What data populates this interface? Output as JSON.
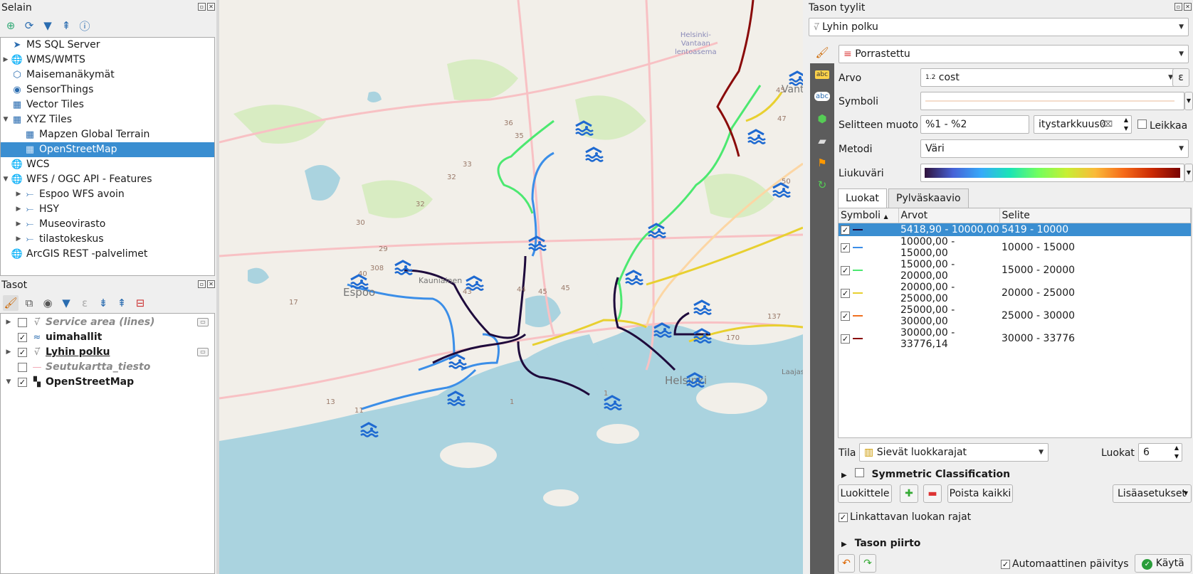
{
  "browser": {
    "title": "Selain",
    "items": [
      {
        "label": "MS SQL Server",
        "icon": "mssql-icon",
        "expand": false,
        "indent": 0
      },
      {
        "label": "WMS/WMTS",
        "icon": "wms-icon",
        "expand": true,
        "indent": 0
      },
      {
        "label": "Maisemanäkymät",
        "icon": "scene-icon",
        "expand": false,
        "indent": 0
      },
      {
        "label": "SensorThings",
        "icon": "sensor-icon",
        "expand": false,
        "indent": 0
      },
      {
        "label": "Vector Tiles",
        "icon": "vector-tiles-icon",
        "expand": false,
        "indent": 0
      },
      {
        "label": "XYZ Tiles",
        "icon": "xyz-tiles-icon",
        "expand": "open",
        "indent": 0
      },
      {
        "label": "Mapzen Global Terrain",
        "icon": "tile-icon",
        "expand": false,
        "indent": 1
      },
      {
        "label": "OpenStreetMap",
        "icon": "tile-icon",
        "expand": false,
        "indent": 1,
        "selected": true
      },
      {
        "label": "WCS",
        "icon": "wcs-icon",
        "expand": false,
        "indent": 0
      },
      {
        "label": "WFS / OGC API - Features",
        "icon": "wfs-icon",
        "expand": "open",
        "indent": 0
      },
      {
        "label": "Espoo WFS avoin",
        "icon": "wfs-conn-icon",
        "expand": true,
        "indent": 1
      },
      {
        "label": "HSY",
        "icon": "wfs-conn-icon",
        "expand": true,
        "indent": 1
      },
      {
        "label": "Museovirasto",
        "icon": "wfs-conn-icon",
        "expand": true,
        "indent": 1
      },
      {
        "label": "tilastokeskus",
        "icon": "wfs-conn-icon",
        "expand": true,
        "indent": 1
      },
      {
        "label": "ArcGIS REST -palvelimet",
        "icon": "arcgis-icon",
        "expand": false,
        "indent": 0
      }
    ]
  },
  "layers": {
    "title": "Tasot",
    "items": [
      {
        "label": "Service area (lines)",
        "checked": false,
        "style": "italic-gray",
        "icon": "line-layer-icon",
        "expand": true
      },
      {
        "label": "uimahallit",
        "checked": true,
        "style": "bold",
        "icon": "swimming-pool-icon",
        "expand": false
      },
      {
        "label": "Lyhin polku",
        "checked": true,
        "style": "bold-underline",
        "icon": "line-layer-icon",
        "expand": true
      },
      {
        "label": "Seutukartta_tiesto",
        "checked": false,
        "style": "italic-gray",
        "icon": "pink-line-icon",
        "expand": false
      },
      {
        "label": "OpenStreetMap",
        "checked": true,
        "style": "bold",
        "icon": "raster-icon",
        "expand": "open"
      }
    ]
  },
  "map": {
    "labels": {
      "espoo": "Espoo",
      "helsinki": "Helsinki",
      "kauniainen": "Kauniainen",
      "airport1": "Helsinki-",
      "airport2": "Vantaan",
      "airport3": "lentoasema",
      "laajasalo": "Laajas",
      "vantaa": "Vant"
    },
    "road_numbers": [
      "36",
      "35",
      "33",
      "32",
      "32",
      "30",
      "29",
      "308",
      "40",
      "45",
      "44",
      "43",
      "45",
      "17",
      "13",
      "11",
      "170",
      "47",
      "45",
      "50",
      "137",
      "1",
      "1"
    ]
  },
  "styles": {
    "title": "Tason tyylit",
    "layer_select": "Lyhin polku",
    "renderer": "Porrastettu",
    "arvo_label": "Arvo",
    "arvo_value": "cost",
    "arvo_prefix": "1.2",
    "symboli_label": "Symboli",
    "selite_label": "Selitteen muoto",
    "selite_value": "%1 - %2",
    "precision_value": "itystarkkuus0",
    "leikkaa_label": "Leikkaa",
    "metodi_label": "Metodi",
    "metodi_value": "Väri",
    "liukuvari_label": "Liukuväri",
    "tabs": [
      "Luokat",
      "Pylväskaavio"
    ],
    "columns": [
      "Symboli",
      "Arvot",
      "Selite"
    ],
    "classes": [
      {
        "range": "5418,90 - 10000,00",
        "legend": "5419 - 10000",
        "color": "#1e0a3c",
        "selected": true
      },
      {
        "range": "10000,00 - 15000,00",
        "legend": "10000 - 15000",
        "color": "#3b8ee8"
      },
      {
        "range": "15000,00 - 20000,00",
        "legend": "15000 - 20000",
        "color": "#4ce870"
      },
      {
        "range": "20000,00 - 25000,00",
        "legend": "20000 - 25000",
        "color": "#e8d030"
      },
      {
        "range": "25000,00 - 30000,00",
        "legend": "25000 - 30000",
        "color": "#f07020"
      },
      {
        "range": "30000,00 - 33776,14",
        "legend": "30000 - 33776",
        "color": "#8a0a0a"
      }
    ],
    "tila_label": "Tila",
    "tila_value": "Sievät luokkarajat",
    "luokat_label": "Luokat",
    "luokat_value": "6",
    "symmetric_label": "Symmetric Classification",
    "luokittele": "Luokittele",
    "poista_kaikki": "Poista kaikki",
    "lisaasetukset": "Lisäasetukset",
    "linkattavan": "Linkattavan luokan rajat",
    "tason_piirto": "Tason piirto",
    "automaattinen": "Automaattinen päivitys",
    "kayta": "Käytä"
  }
}
